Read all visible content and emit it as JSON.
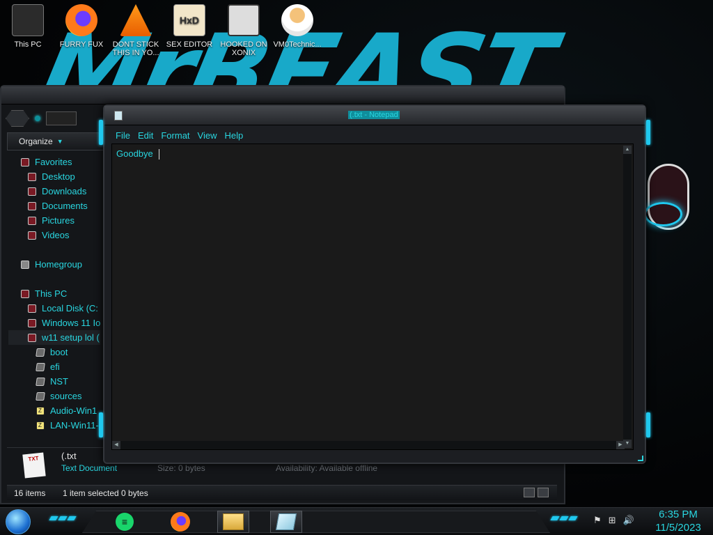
{
  "desktop": {
    "icons": [
      {
        "label": "This PC"
      },
      {
        "label": "FURRY FUX"
      },
      {
        "label": "DONT STICK THIS IN YO..."
      },
      {
        "label": "SEX EDITOR"
      },
      {
        "label": "HOOKED ON XONIX"
      },
      {
        "label": "VM0Technic..."
      }
    ],
    "wallpaper_text": "MrBEAST"
  },
  "explorer": {
    "toolbar": {
      "organize_label": "Organize"
    },
    "nav": {
      "favorites": "Favorites",
      "desktop": "Desktop",
      "downloads": "Downloads",
      "documents": "Documents",
      "pictures": "Pictures",
      "videos": "Videos",
      "homegroup": "Homegroup",
      "this_pc": "This PC",
      "local_disk": "Local Disk (C:",
      "windows11": "Windows 11 Io",
      "w11_setup": "w11 setup lol (",
      "boot": "boot",
      "efi": "efi",
      "nst": "NST",
      "sources": "sources",
      "audio": "Audio-Win1",
      "lan": "LAN-Win11-"
    },
    "details": {
      "file_name": "(.txt",
      "file_type": "Text Document",
      "size": "Size: 0 bytes",
      "availability": "Availability: Available offline",
      "icon_text": "TXT"
    },
    "status": {
      "item_count": "16 items",
      "selection": "1 item selected  0 bytes"
    }
  },
  "notepad": {
    "title": "(.txt - Notepad",
    "menu": [
      "File",
      "Edit",
      "Format",
      "View",
      "Help"
    ],
    "content": "Goodbye"
  },
  "taskbar": {
    "time": "6:35 PM",
    "date": "11/5/2023"
  },
  "colors": {
    "accent": "#29d6e0",
    "background": "#050608",
    "window": "#141619"
  }
}
